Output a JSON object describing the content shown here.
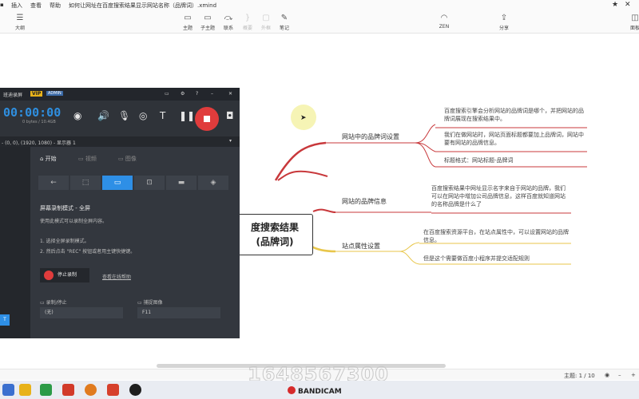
{
  "menubar": {
    "items": [
      "插入",
      "查看",
      "帮助"
    ],
    "document_title": "如何让网址在百度搜索结果显示网站名称（品牌词）.xmind",
    "star": "★"
  },
  "toolbar": {
    "outline_label": "大纲",
    "topic_label": "主题",
    "subtopic_label": "子主题",
    "relation_label": "联系",
    "summary_label": "概要",
    "boundary_label": "外框",
    "note_label": "笔记",
    "zen_label": "ZEN",
    "share_label": "分享",
    "panel_label": "面板"
  },
  "mindmap": {
    "central_line1": "度搜索结果",
    "central_line2": "(品牌词)",
    "colors": {
      "red": "#c8383b",
      "yellow": "#e8c64a",
      "branch_line": "#c8383b"
    },
    "branches": [
      {
        "label": "网站中的品牌词设置",
        "leaves": [
          "百度搜索引擎会分析网站的品牌词是哪个，并把网站的品牌词展现在搜索结果中。",
          "我们在做网站时，网站页面标题都要加上品牌词，网站中要有网站的品牌信息。",
          "标题格式：网站标题-品牌词"
        ]
      },
      {
        "label": "网站的品牌信息",
        "leaves": [
          "百度搜索结果中网址显示名字来自于网站的品牌，我们可以在网站中增加公司品牌信息，这样百度就知道网站的名称品牌是什么了"
        ]
      },
      {
        "label": "站点属性设置",
        "leaves": [
          "在百度搜索资源平台，在站点属性中，可以设置网站的品牌信息。",
          "但是这个需要做百度小程序并提交适配规则"
        ]
      }
    ]
  },
  "bandicam": {
    "title": "班迪录屏",
    "vip": "VIP",
    "admin": "ADMIN",
    "timer": "00:00:00",
    "size": "0 bytes / 10.4GB",
    "resolution": "- (0, 0), (1920, 1080) - 显示器 1",
    "tabs": {
      "start": "开始",
      "video": "视频",
      "image": "图像"
    },
    "heading": "屏幕录制模式 - 全屏",
    "desc": "使用此模式可以录制全屏内容。",
    "step1": "1. 选择全屏录制模式。",
    "step2": "2. 然后点击 \"REC\" 按钮或者用主键快捷键。",
    "stop_label": "停止录制",
    "help_link": "查看在线帮助",
    "hotkey_record_label": "录制/停止",
    "hotkey_record_value": "(无)",
    "hotkey_capture_label": "捕捉图像",
    "hotkey_capture_value": "F11"
  },
  "status": {
    "topic_count": "主题: 1 / 10",
    "zoom_minus": "–",
    "zoom_plus": "+"
  },
  "watermark": "1648567300",
  "taskbar": {
    "bandicam_label": "BANDICAM"
  }
}
